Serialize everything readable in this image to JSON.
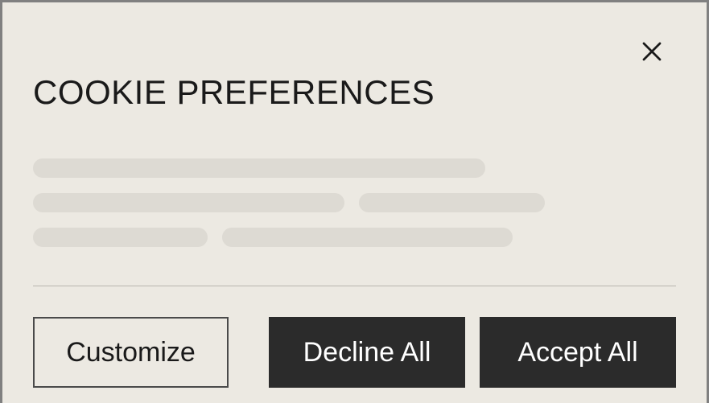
{
  "modal": {
    "title": "COOKIE PREFERENCES",
    "buttons": {
      "customize": "Customize",
      "decline": "Decline All",
      "accept": "Accept All"
    }
  }
}
